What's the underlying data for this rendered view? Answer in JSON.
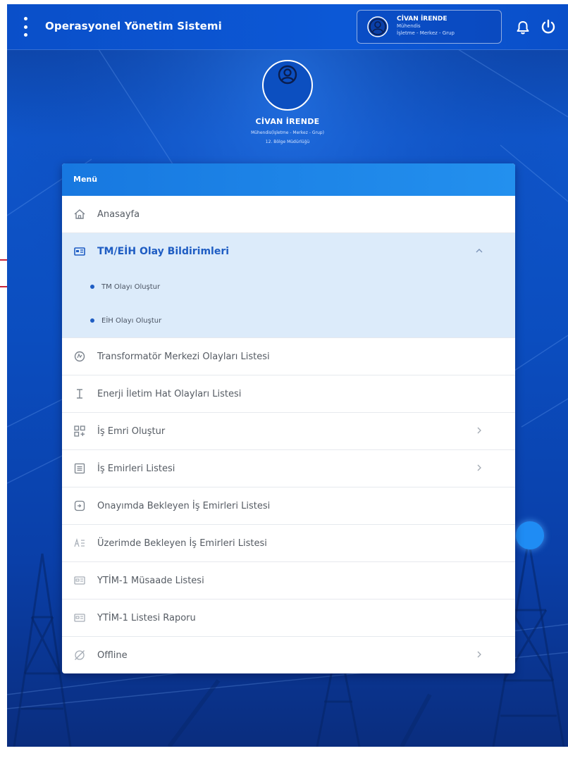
{
  "app": {
    "title": "Operasyonel Yönetim Sistemi"
  },
  "user_chip": {
    "name": "CİVAN İRENDE",
    "role": "Mühendis",
    "unit": "İşletme - Merkez - Grup"
  },
  "profile": {
    "name": "CİVAN İRENDE",
    "role": "Mühendis(İşletme - Merkez - Grup)",
    "unit": "12. Bölge Müdürlüğü"
  },
  "menu": {
    "header": "Menü",
    "items": [
      {
        "label": "Anasayfa",
        "icon": "home-icon"
      },
      {
        "label": "TM/EİH Olay Bildirimleri",
        "icon": "report-icon",
        "expanded": true,
        "children": [
          {
            "label": "TM Olayı Oluştur"
          },
          {
            "label": "EİH Olayı Oluştur"
          }
        ]
      },
      {
        "label": "Transformatör Merkezi Olayları Listesi",
        "icon": "transformer-icon"
      },
      {
        "label": "Enerji İletim Hat Olayları Listesi",
        "icon": "tower-icon"
      },
      {
        "label": "İş Emri Oluştur",
        "icon": "grid-add-icon",
        "has_children": true
      },
      {
        "label": "İş Emirleri Listesi",
        "icon": "list-icon",
        "has_children": true
      },
      {
        "label": "Onayımda Bekleyen İş Emirleri Listesi",
        "icon": "approval-icon"
      },
      {
        "label": "Üzerimde Bekleyen İş Emirleri Listesi",
        "icon": "assigned-icon"
      },
      {
        "label": "YTİM-1 Müsaade Listesi",
        "icon": "permit-icon"
      },
      {
        "label": "YTİM-1 Listesi Raporu",
        "icon": "permit-report-icon"
      },
      {
        "label": "Offline",
        "icon": "offline-icon",
        "has_children": true
      }
    ]
  },
  "colors": {
    "primary": "#0c58d6",
    "menu_header": "#1f86ea",
    "active_bg": "#dcebfa",
    "active_text": "#1f5dc3",
    "annotation": "#c7243a"
  }
}
